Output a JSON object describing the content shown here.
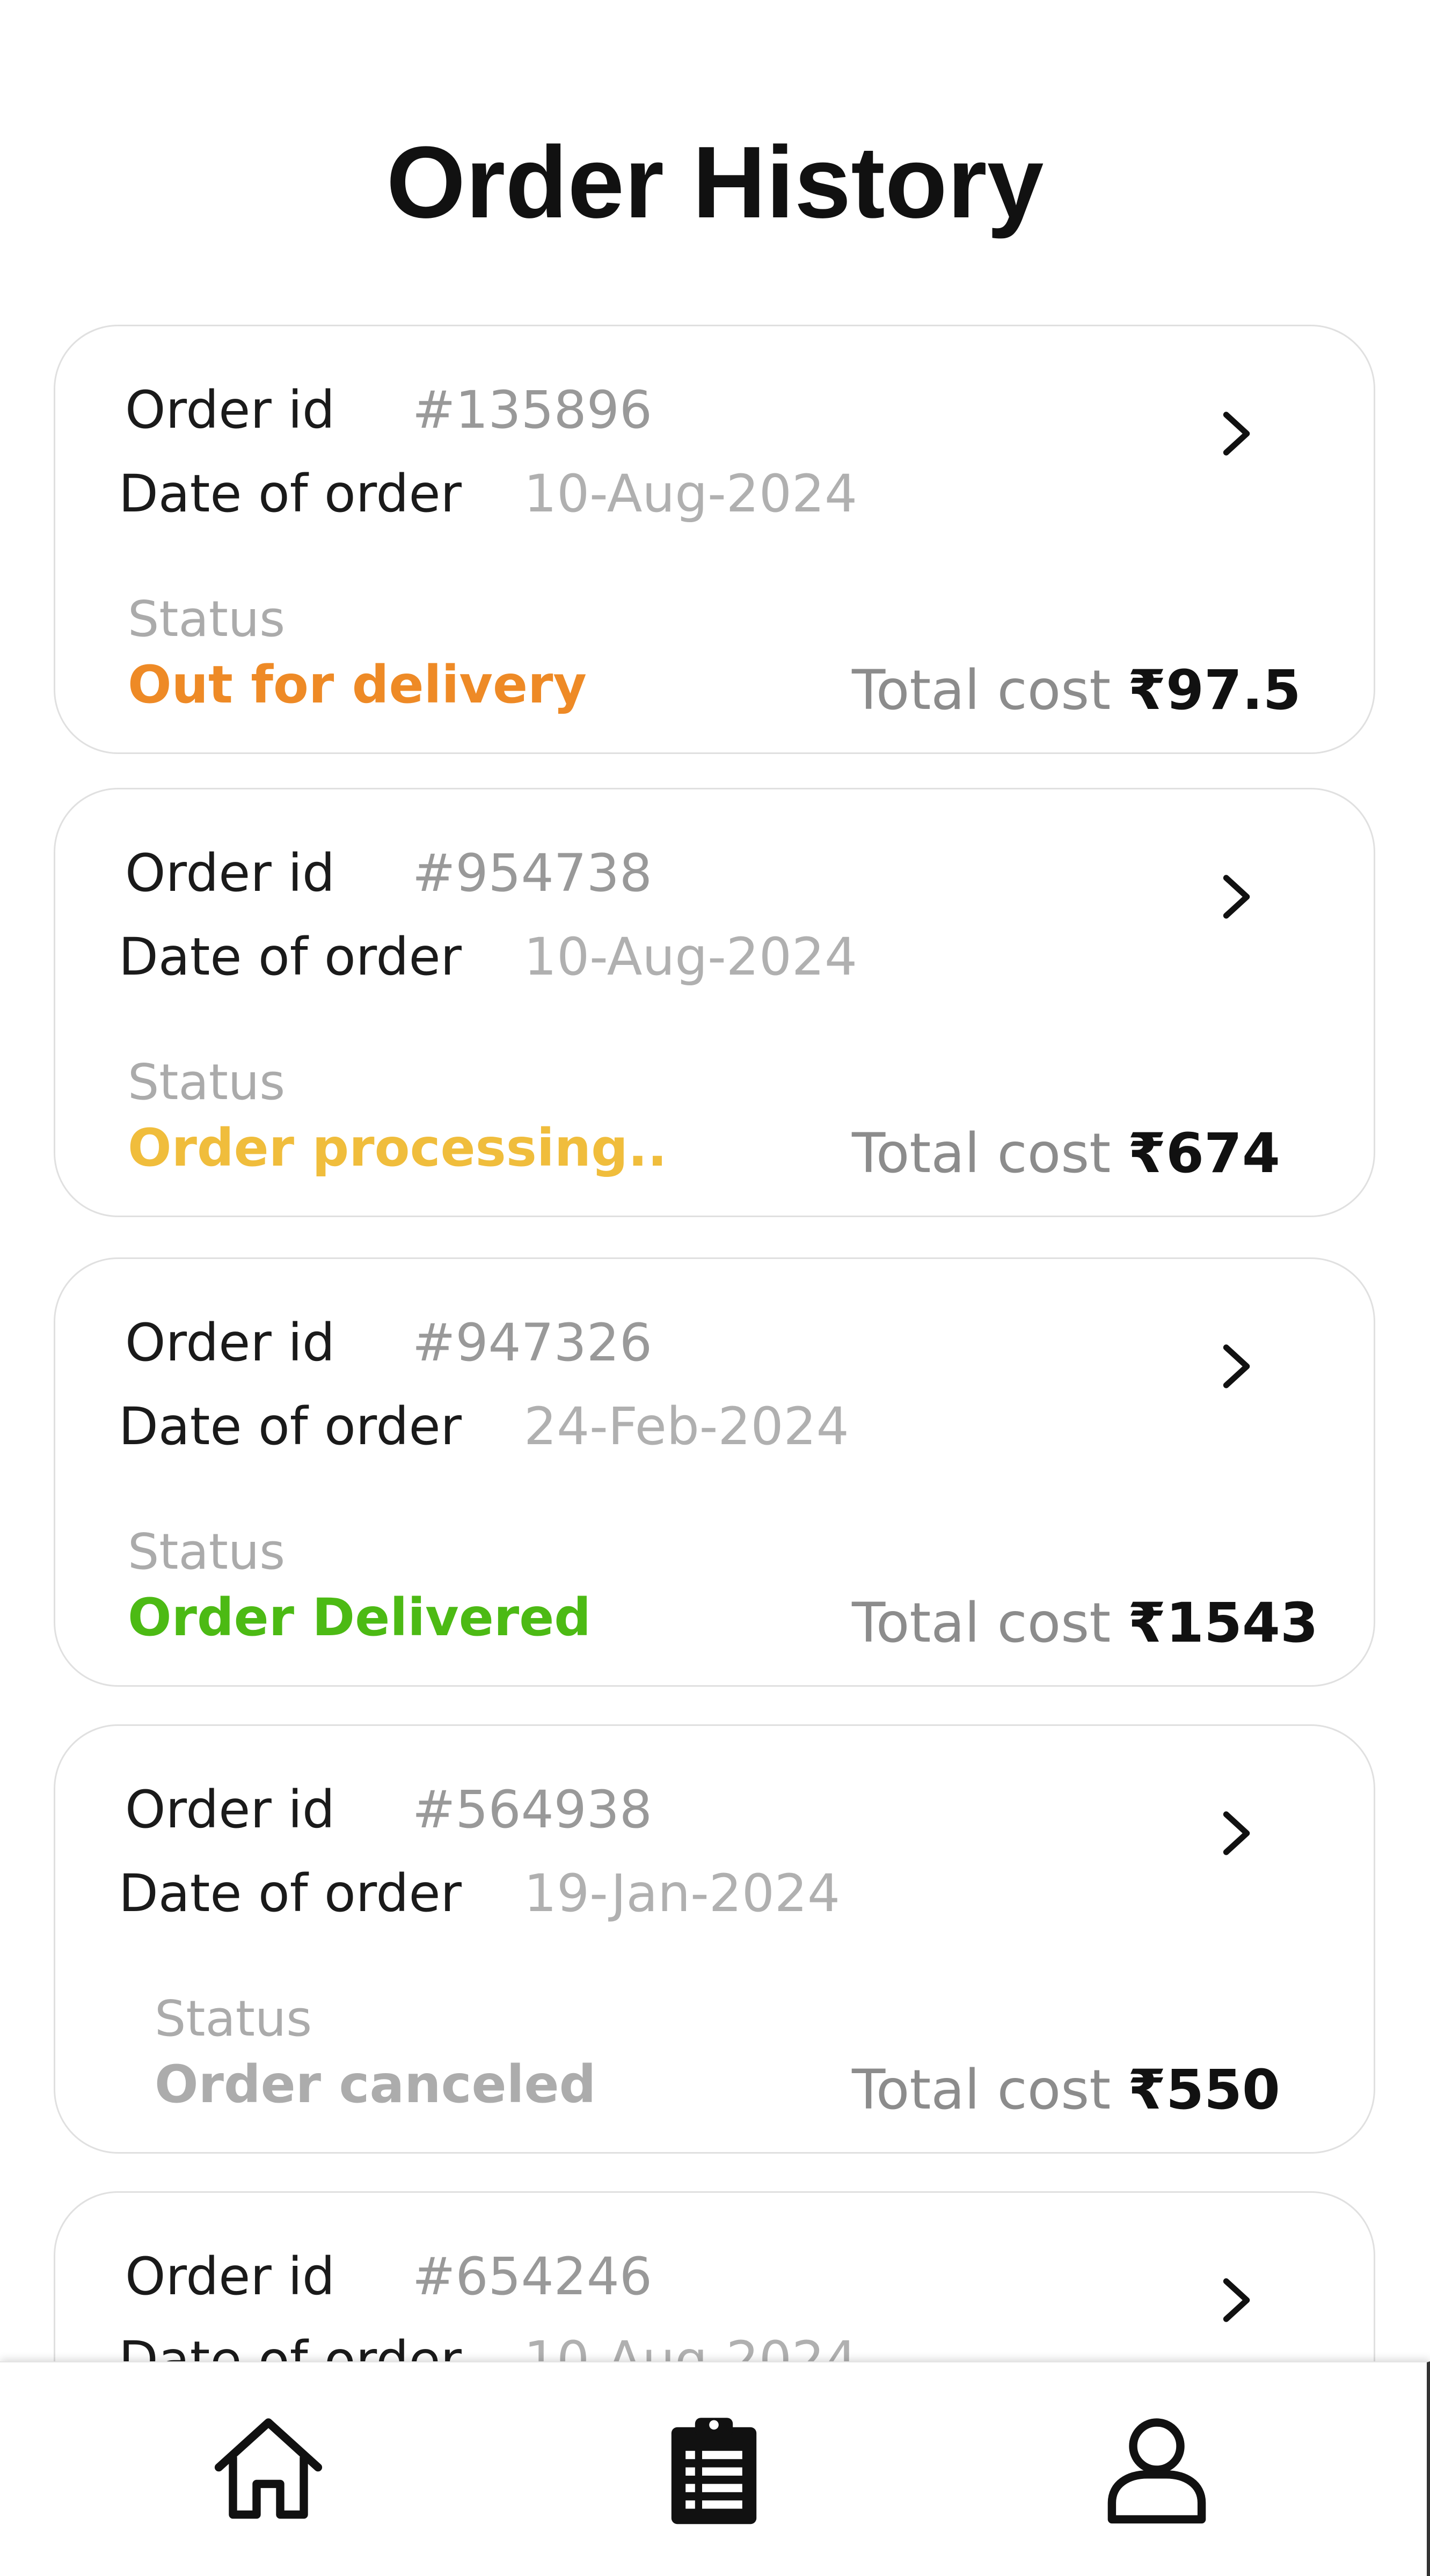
{
  "header": {
    "title": "Order History"
  },
  "orders": [
    {
      "order_id_label": "Order id",
      "order_id": "#135896",
      "date_label": "Date of order",
      "date": "10-Aug-2024",
      "status_label": "Status",
      "status": "Out for delivery",
      "status_color": "#ee8a26",
      "total_label": "Total cost",
      "total": "₹97.5",
      "chevron_icon": "chevron-right-icon"
    },
    {
      "order_id_label": "Order id",
      "order_id": "#954738",
      "date_label": "Date of order",
      "date": "10-Aug-2024",
      "status_label": "Status",
      "status": "Order processing..",
      "status_color": "#f0bd3c",
      "total_label": "Total cost",
      "total": "₹674",
      "chevron_icon": "chevron-right-icon"
    },
    {
      "order_id_label": "Order id",
      "order_id": "#947326",
      "date_label": "Date of order",
      "date": "24-Feb-2024",
      "status_label": "Status",
      "status": "Order Delivered",
      "status_color": "#4cba14",
      "total_label": "Total cost",
      "total": "₹1543",
      "chevron_icon": "chevron-right-icon"
    },
    {
      "order_id_label": "Order id",
      "order_id": "#564938",
      "date_label": "Date of order",
      "date": "19-Jan-2024",
      "status_label": "Status",
      "status": "Order canceled",
      "status_color": "#acacac",
      "total_label": "Total cost",
      "total": "₹550",
      "chevron_icon": "chevron-right-icon"
    },
    {
      "order_id_label": "Order id",
      "order_id": "#654246",
      "date_label": "Date of order",
      "date": "10-Aug-2024",
      "chevron_icon": "chevron-right-icon"
    }
  ],
  "bottom_nav": {
    "items": [
      {
        "icon": "home-icon",
        "active": false
      },
      {
        "icon": "clipboard-list-icon",
        "active": true
      },
      {
        "icon": "user-icon",
        "active": false
      }
    ]
  }
}
